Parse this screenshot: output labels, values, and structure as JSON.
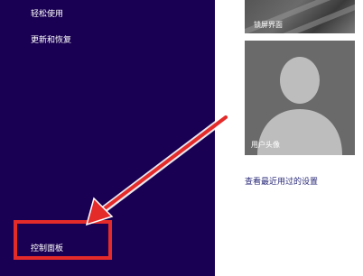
{
  "left_menu": {
    "items": [
      {
        "label": "轻松使用"
      },
      {
        "label": "更新和恢复"
      },
      {
        "label": "控制面板"
      }
    ]
  },
  "tiles": {
    "lock_screen_label": "锁屏界面",
    "account_picture_label": "用户头像"
  },
  "recent_settings_link": "查看最近用过的设置",
  "colors": {
    "left_pane": "#190052",
    "annotation": "#e52a2a"
  }
}
